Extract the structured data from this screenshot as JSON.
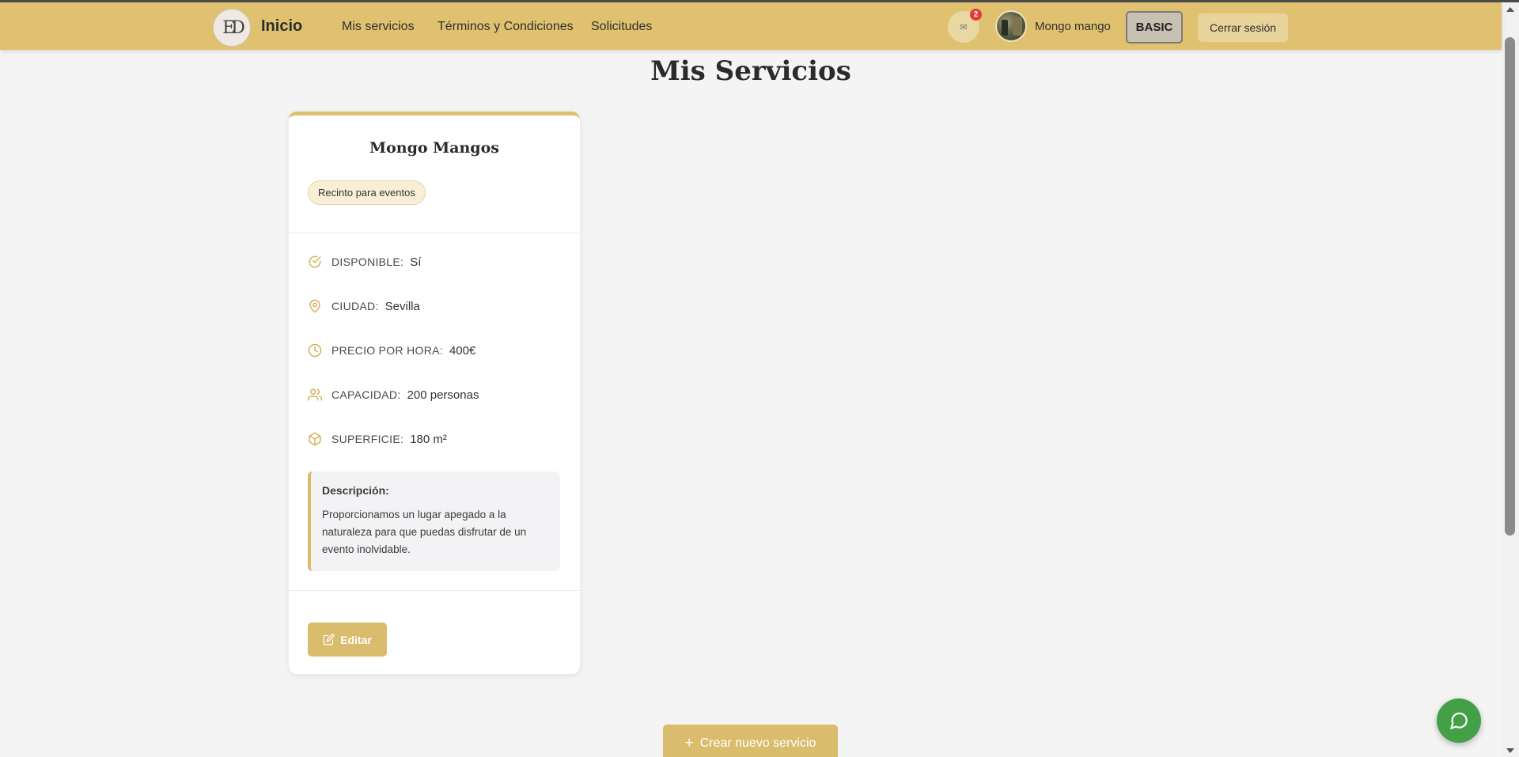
{
  "header": {
    "logo_text": "ED",
    "brand": "Inicio",
    "nav": [
      {
        "label": "Mis servicios"
      },
      {
        "label": "Términos y Condiciones"
      },
      {
        "label": "Solicitudes"
      }
    ],
    "messages_icon": "envelope-icon",
    "messages_badge": "2",
    "username": "Mongo mango",
    "plan": "BASIC",
    "logout": "Cerrar sesión"
  },
  "page": {
    "title": "Mis Servicios"
  },
  "service": {
    "name": "Mongo Mangos",
    "category": "Recinto para eventos",
    "fields": [
      {
        "icon": "check-circle-icon",
        "label": "DISPONIBLE:",
        "value": "Sí"
      },
      {
        "icon": "map-pin-icon",
        "label": "CIUDAD:",
        "value": "Sevilla"
      },
      {
        "icon": "clock-icon",
        "label": "PRECIO POR HORA:",
        "value": "400€"
      },
      {
        "icon": "users-icon",
        "label": "CAPACIDAD:",
        "value": "200 personas"
      },
      {
        "icon": "box-icon",
        "label": "SUPERFICIE:",
        "value": "180 m²"
      }
    ],
    "description_label": "Descripción:",
    "description": "Proporcionamos un lugar apegado a la naturaleza para que puedas disfrutar de un evento inolvidable.",
    "edit_label": "Editar"
  },
  "actions": {
    "create_label": "Crear nuevo servicio",
    "create_icon": "plus-icon"
  },
  "chat_icon": "chat-icon",
  "colors": {
    "header": "#dfc16f",
    "accent": "#d9bc6c",
    "badge": "#e53935",
    "chat": "#43a047",
    "background": "#f4f4f4"
  }
}
